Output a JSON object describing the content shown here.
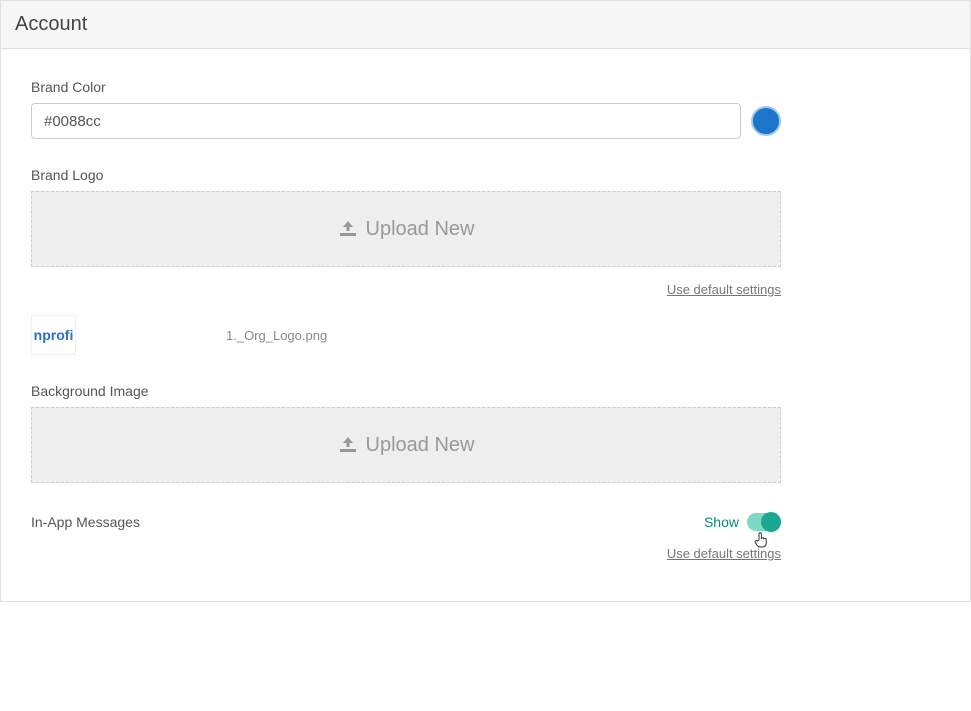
{
  "header": {
    "title": "Account"
  },
  "brandColor": {
    "label": "Brand Color",
    "value": "#0088cc",
    "swatch": "#1d75c9"
  },
  "brandLogo": {
    "label": "Brand Logo",
    "uploadText": "Upload New",
    "defaultLink": "Use default settings",
    "previewText": "nprofi",
    "filename": "1._Org_Logo.png"
  },
  "backgroundImage": {
    "label": "Background Image",
    "uploadText": "Upload New"
  },
  "inApp": {
    "label": "In-App Messages",
    "toggleLabel": "Show",
    "defaultLink": "Use default settings"
  }
}
